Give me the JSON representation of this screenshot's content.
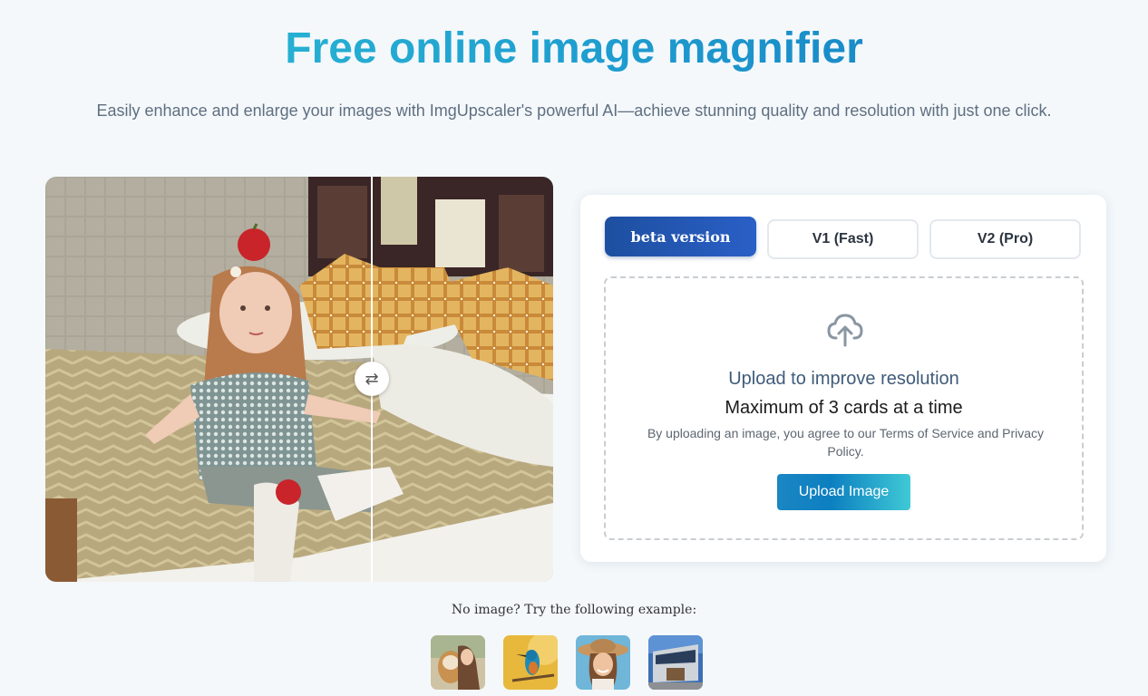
{
  "header": {
    "title": "Free online image magnifier",
    "subtitle": "Easily enhance and enlarge your images with ImgUpscaler's powerful AI—achieve stunning quality and resolution with just one click."
  },
  "compare": {
    "handle_icon": "swap-arrows-icon",
    "handle_glyph": "⇄"
  },
  "tabs": [
    {
      "label": "beta version",
      "active": true
    },
    {
      "label": "V1 (Fast)",
      "active": false
    },
    {
      "label": "V2 (Pro)",
      "active": false
    }
  ],
  "upload": {
    "icon": "cloud-upload-icon",
    "title": "Upload to improve resolution",
    "max": "Maximum of 3 cards at a time",
    "terms": "By uploading an image, you agree to our Terms of Service and Privacy Policy.",
    "button_label": "Upload Image"
  },
  "examples": {
    "label": "No image? Try the following example:",
    "items": [
      "dog-and-woman-thumb",
      "kingfisher-thumb",
      "woman-with-hat-thumb",
      "building-thumb"
    ]
  },
  "colors": {
    "title_gradient_start": "#2ec0d5",
    "title_gradient_end": "#1477c0",
    "active_tab": "#1d4fa0",
    "upload_button": "#0c7fc0"
  }
}
